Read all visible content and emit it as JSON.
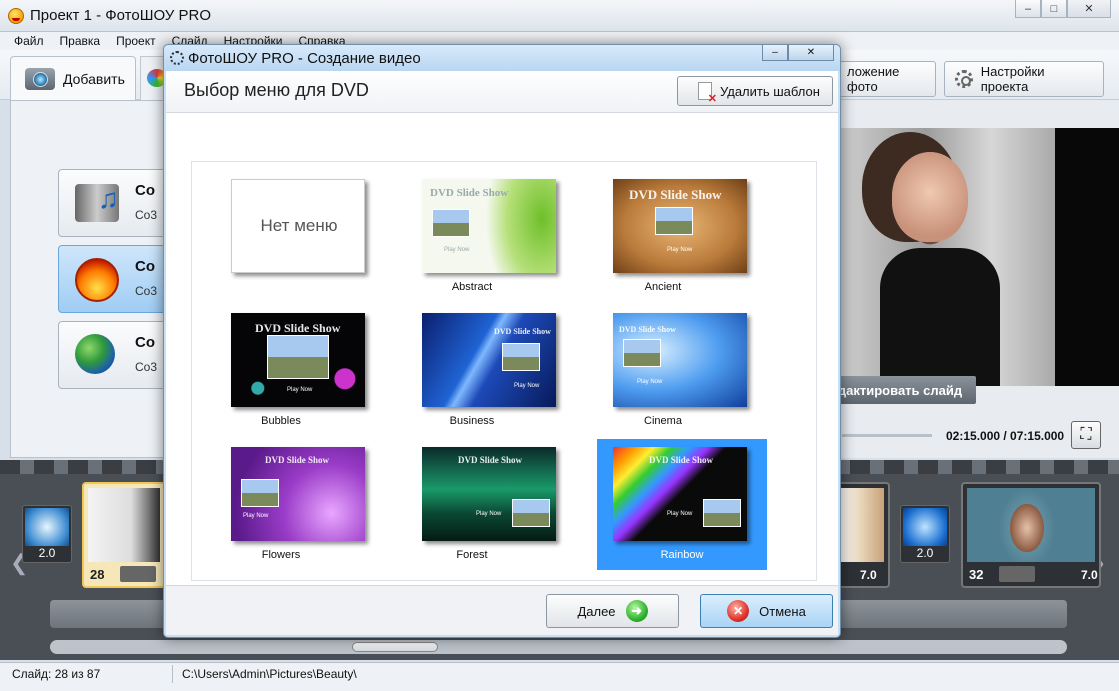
{
  "window": {
    "title": "Проект 1 - ФотоШОУ PRO",
    "minimize": "‒",
    "maximize": "□",
    "close": "✕"
  },
  "menu": [
    "Файл",
    "Правка",
    "Проект",
    "Слайд",
    "Настройки",
    "Справка"
  ],
  "toolbar": {
    "add_label": "Добавить",
    "photo_label": "ложение фото",
    "settings_label": "Настройки проекта"
  },
  "left_modes": [
    {
      "title": "Co",
      "sub": "Co3"
    },
    {
      "title": "Co",
      "sub": "Co3"
    },
    {
      "title": "Co",
      "sub": "Co3"
    }
  ],
  "preview": {
    "edit_slide_label": "дактировать слайд",
    "time": "02:15.000 / 07:15.000",
    "fullscreen": "⛶"
  },
  "filmstrip": {
    "thumbs": [
      {
        "num": "28",
        "selected": true
      },
      {
        "num": "32",
        "selected": false
      }
    ],
    "durations": [
      "2.0",
      "7.0",
      "2.0",
      "7.0"
    ],
    "arrow_left": "❮",
    "arrow_right": "❯"
  },
  "status": {
    "slide": "Слайд: 28 из 87",
    "path": "C:\\Users\\Admin\\Pictures\\Beauty\\"
  },
  "dialog": {
    "title": "ФотоШОУ PRO - Создание видео",
    "heading": "Выбор меню для DVD",
    "delete_label": "Удалить шаблон",
    "next_label": "Далее",
    "cancel_label": "Отмена",
    "minimize": "‒",
    "close": "✕",
    "templates": [
      {
        "name": "",
        "preview_text": "Нет меню",
        "selected": false
      },
      {
        "name": "Abstract",
        "selected": false
      },
      {
        "name": "Ancient",
        "selected": false
      },
      {
        "name": "Bubbles",
        "selected": false
      },
      {
        "name": "Business",
        "selected": false
      },
      {
        "name": "Cinema",
        "selected": false
      },
      {
        "name": "Flowers",
        "selected": false
      },
      {
        "name": "Forest",
        "selected": false
      },
      {
        "name": "Rainbow",
        "selected": true
      }
    ],
    "slide_show_text": "DVD Slide Show",
    "play_text": "Play Now"
  }
}
